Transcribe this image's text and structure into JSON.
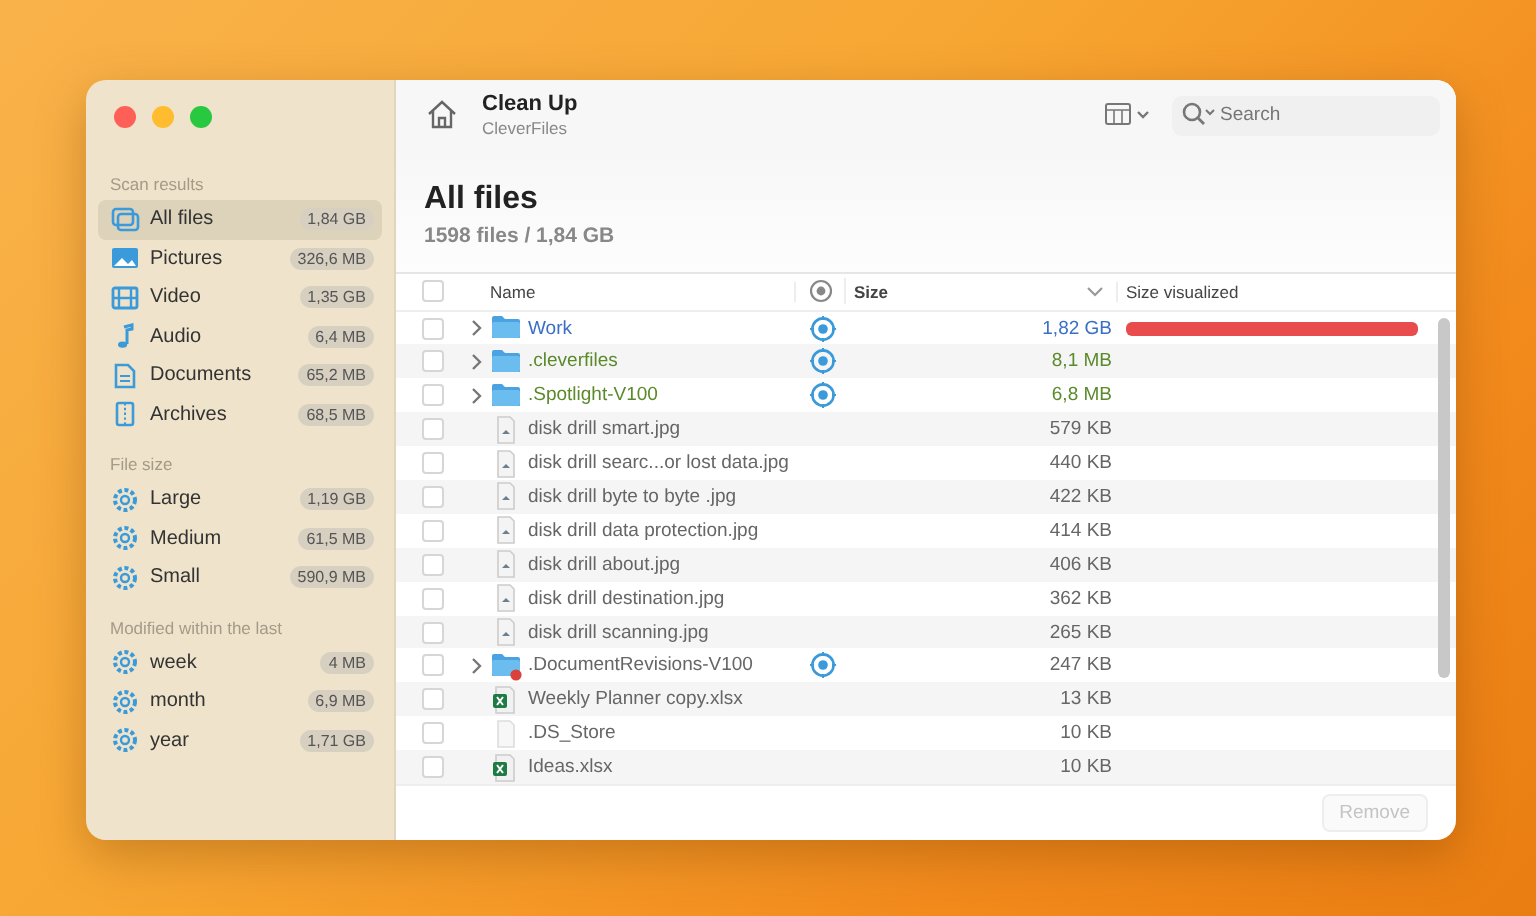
{
  "window": {
    "title": "Clean Up",
    "subtitle": "CleverFiles"
  },
  "sidebar": {
    "sections": [
      {
        "heading": "Scan results",
        "items": [
          {
            "kind": "stack",
            "label": "All files",
            "badge": "1,84 GB",
            "selected": true
          },
          {
            "kind": "picture",
            "label": "Pictures",
            "badge": "326,6 MB",
            "selected": false
          },
          {
            "kind": "film",
            "label": "Video",
            "badge": "1,35 GB",
            "selected": false
          },
          {
            "kind": "note",
            "label": "Audio",
            "badge": "6,4 MB",
            "selected": false
          },
          {
            "kind": "document",
            "label": "Documents",
            "badge": "65,2 MB",
            "selected": false
          },
          {
            "kind": "archive",
            "label": "Archives",
            "badge": "68,5 MB",
            "selected": false
          }
        ]
      },
      {
        "heading": "File size",
        "items": [
          {
            "kind": "gear",
            "label": "Large",
            "badge": "1,19 GB",
            "selected": false
          },
          {
            "kind": "gear",
            "label": "Medium",
            "badge": "61,5 MB",
            "selected": false
          },
          {
            "kind": "gear",
            "label": "Small",
            "badge": "590,9 MB",
            "selected": false
          }
        ]
      },
      {
        "heading": "Modified within the last",
        "items": [
          {
            "kind": "gear",
            "label": "week",
            "badge": "4 MB",
            "selected": false
          },
          {
            "kind": "gear",
            "label": "month",
            "badge": "6,9 MB",
            "selected": false
          },
          {
            "kind": "gear",
            "label": "year",
            "badge": "1,71 GB",
            "selected": false
          }
        ]
      }
    ]
  },
  "search": {
    "placeholder": "Search"
  },
  "heading": {
    "title": "All files",
    "summary": "1598 files / 1,84 GB"
  },
  "table": {
    "select_all": {
      "checked": false
    },
    "columns": [
      "Name",
      "Size",
      "Size visualized"
    ],
    "rows": [
      {
        "kind": "folder",
        "name": "Work",
        "size": "1,82 GB",
        "color": "#3a6fc4",
        "checked": false,
        "expanded": false,
        "target": true,
        "level": 0.99
      },
      {
        "kind": "folder",
        "name": ".cleverfiles",
        "size": "8,1 MB",
        "color": "#5a8a2a",
        "checked": false,
        "expanded": false,
        "target": true
      },
      {
        "kind": "folder",
        "name": ".Spotlight-V100",
        "size": "6,8 MB",
        "color": "#5a8a2a",
        "checked": false,
        "expanded": false,
        "target": true
      },
      {
        "kind": "image",
        "name": "disk drill smart.jpg",
        "size": "579 KB",
        "color": "#666666",
        "checked": false,
        "target": false
      },
      {
        "kind": "image",
        "name": "disk drill searc...or lost data.jpg",
        "size": "440 KB",
        "color": "#666666",
        "checked": false,
        "target": false
      },
      {
        "kind": "image",
        "name": "disk drill byte to byte .jpg",
        "size": "422 KB",
        "color": "#666666",
        "checked": false,
        "target": false
      },
      {
        "kind": "image",
        "name": "disk drill data protection.jpg",
        "size": "414 KB",
        "color": "#666666",
        "checked": false,
        "target": false
      },
      {
        "kind": "image",
        "name": "disk drill about.jpg",
        "size": "406 KB",
        "color": "#666666",
        "checked": false,
        "target": false
      },
      {
        "kind": "image",
        "name": "disk drill destination.jpg",
        "size": "362 KB",
        "color": "#666666",
        "checked": false,
        "target": false
      },
      {
        "kind": "image",
        "name": "disk drill scanning.jpg",
        "size": "265 KB",
        "color": "#666666",
        "checked": false,
        "target": false
      },
      {
        "kind": "folder-badged",
        "name": ".DocumentRevisions-V100",
        "size": "247 KB",
        "color": "#666666",
        "checked": false,
        "expanded": false,
        "target": true
      },
      {
        "kind": "sheet",
        "name": "Weekly Planner copy.xlsx",
        "size": "13 KB",
        "color": "#666666",
        "checked": false,
        "target": false
      },
      {
        "kind": "blank",
        "name": ".DS_Store",
        "size": "10 KB",
        "color": "#666666",
        "checked": false,
        "target": false
      },
      {
        "kind": "sheet",
        "name": "Ideas.xlsx",
        "size": "10 KB",
        "color": "#666666",
        "checked": false,
        "target": false
      }
    ]
  },
  "remove_button": {
    "label": "Remove",
    "disabled": true
  }
}
